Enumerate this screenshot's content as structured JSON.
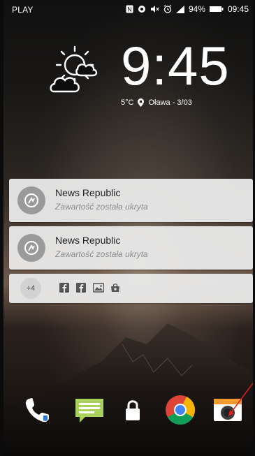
{
  "status_bar": {
    "carrier": "PLAY",
    "battery_percent": "94%",
    "time": "09:45",
    "icons": [
      "nfc-icon",
      "sync-icon",
      "mute-icon",
      "alarm-icon",
      "signal-icon",
      "battery-icon"
    ]
  },
  "lockscreen": {
    "time": "9:45",
    "temperature": "5°C",
    "location": "Oława - 3/03",
    "weather_icon": "partly-cloudy-icon"
  },
  "notifications": [
    {
      "app_name": "News Republic",
      "content": "Zawartość została ukryta",
      "icon": "news-republic-icon"
    },
    {
      "app_name": "News Republic",
      "content": "Zawartość została ukryta",
      "icon": "news-republic-icon"
    }
  ],
  "summary": {
    "more_count": "+4",
    "icons": [
      "facebook-icon",
      "facebook-icon",
      "gallery-icon",
      "store-icon"
    ]
  },
  "dock": {
    "items": [
      "phone-icon",
      "messages-icon",
      "lock-icon",
      "chrome-icon",
      "camera-icon"
    ]
  },
  "colors": {
    "notification_bg": "#e8e8e8",
    "annotation_arrow": "#e02020"
  }
}
